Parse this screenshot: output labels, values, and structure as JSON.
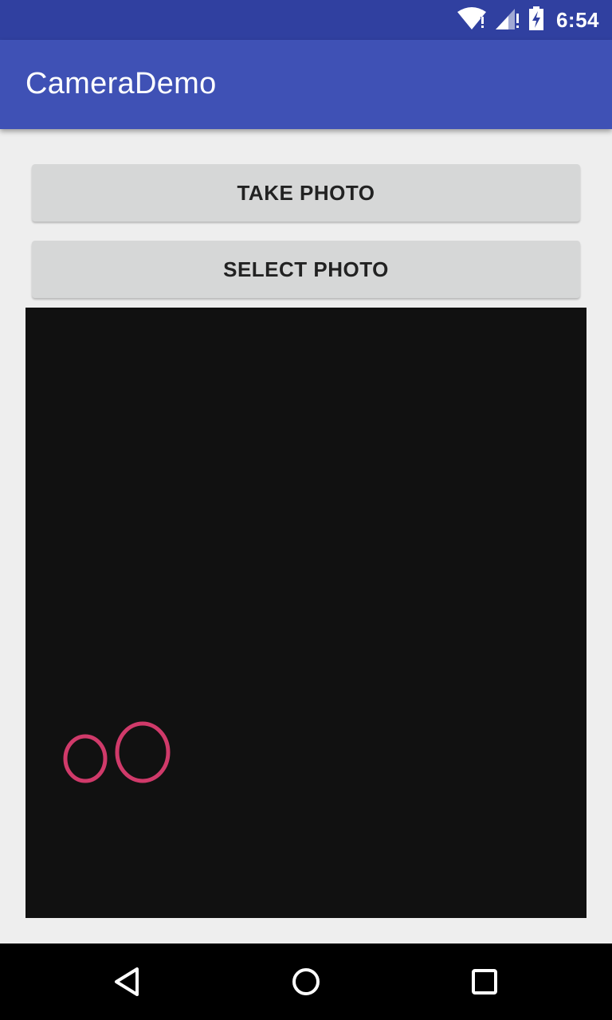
{
  "status_bar": {
    "time": "6:54",
    "icons": [
      "wifi-alert-icon",
      "signal-alert-icon",
      "battery-charging-icon"
    ],
    "color": "#3040a0"
  },
  "app_bar": {
    "title": "CameraDemo",
    "color": "#3f51b5"
  },
  "buttons": {
    "take_photo": "TAKE PHOTO",
    "select_photo": "SELECT PHOTO"
  },
  "image_view": {
    "background": "#111111",
    "content": "oO",
    "content_color": "#d03a6a"
  },
  "nav_bar": {
    "icons": [
      "back-icon",
      "home-icon",
      "recents-icon"
    ]
  }
}
